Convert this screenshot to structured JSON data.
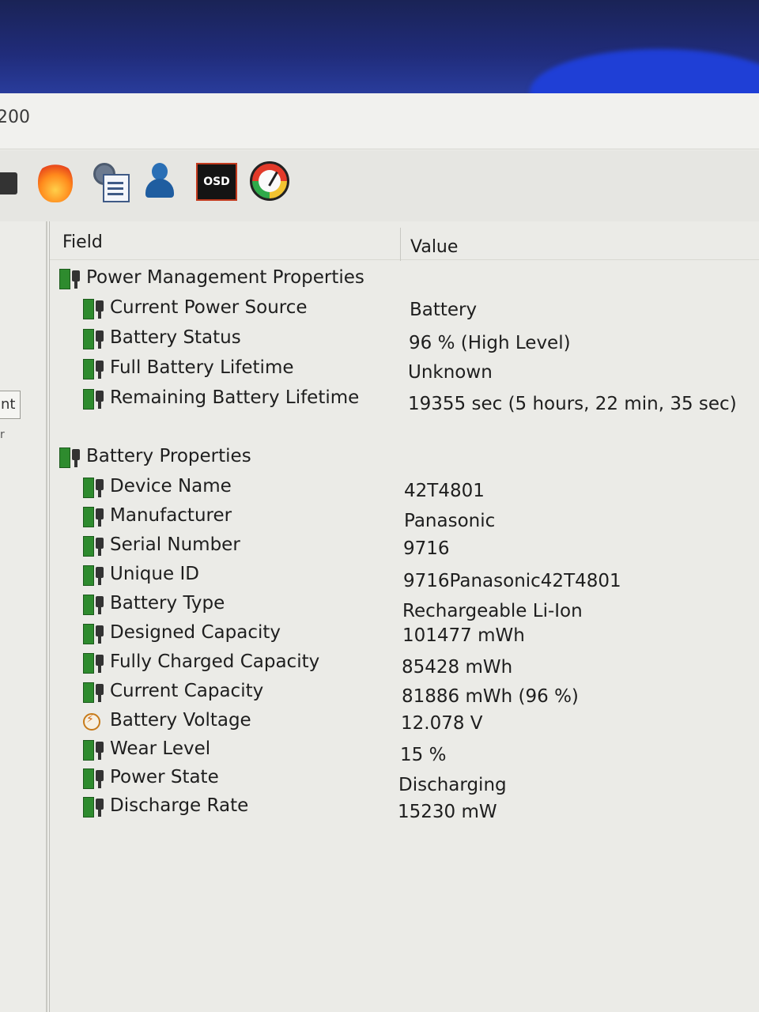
{
  "window": {
    "title_fragment": "200"
  },
  "toolbar": {
    "buttons": [
      {
        "icon": "partial-monitor-icon"
      },
      {
        "icon": "flame-icon"
      },
      {
        "icon": "scheduler-icon"
      },
      {
        "icon": "user-icon"
      },
      {
        "icon": "osd-icon",
        "label": "OSD"
      },
      {
        "icon": "gauge-icon"
      }
    ]
  },
  "side_panel": {
    "tab_fragment": "nt",
    "sub_fragment": "r"
  },
  "columns": {
    "field": "Field",
    "value": "Value"
  },
  "sections": [
    {
      "title": "Power Management Properties",
      "rows": [
        {
          "label": "Current Power Source",
          "value": "Battery"
        },
        {
          "label": "Battery Status",
          "value": "96 % (High Level)"
        },
        {
          "label": "Full Battery Lifetime",
          "value": "Unknown"
        },
        {
          "label": "Remaining Battery Lifetime",
          "value": "19355 sec (5 hours, 22 min, 35 sec)"
        }
      ]
    },
    {
      "title": "Battery Properties",
      "rows": [
        {
          "label": "Device Name",
          "value": "42T4801"
        },
        {
          "label": "Manufacturer",
          "value": "Panasonic"
        },
        {
          "label": "Serial Number",
          "value": "9716"
        },
        {
          "label": "Unique ID",
          "value": "9716Panasonic42T4801"
        },
        {
          "label": "Battery Type",
          "value": "Rechargeable Li-Ion"
        },
        {
          "label": "Designed Capacity",
          "value": "101477 mWh"
        },
        {
          "label": "Fully Charged Capacity",
          "value": "85428 mWh"
        },
        {
          "label": "Current Capacity",
          "value": "81886 mWh  (96 %)"
        },
        {
          "label": "Battery Voltage",
          "value": "12.078 V",
          "icon": "voltage-icon"
        },
        {
          "label": "Wear Level",
          "value": "15 %"
        },
        {
          "label": "Power State",
          "value": "Discharging"
        },
        {
          "label": "Discharge Rate",
          "value": "15230 mW"
        }
      ]
    }
  ]
}
